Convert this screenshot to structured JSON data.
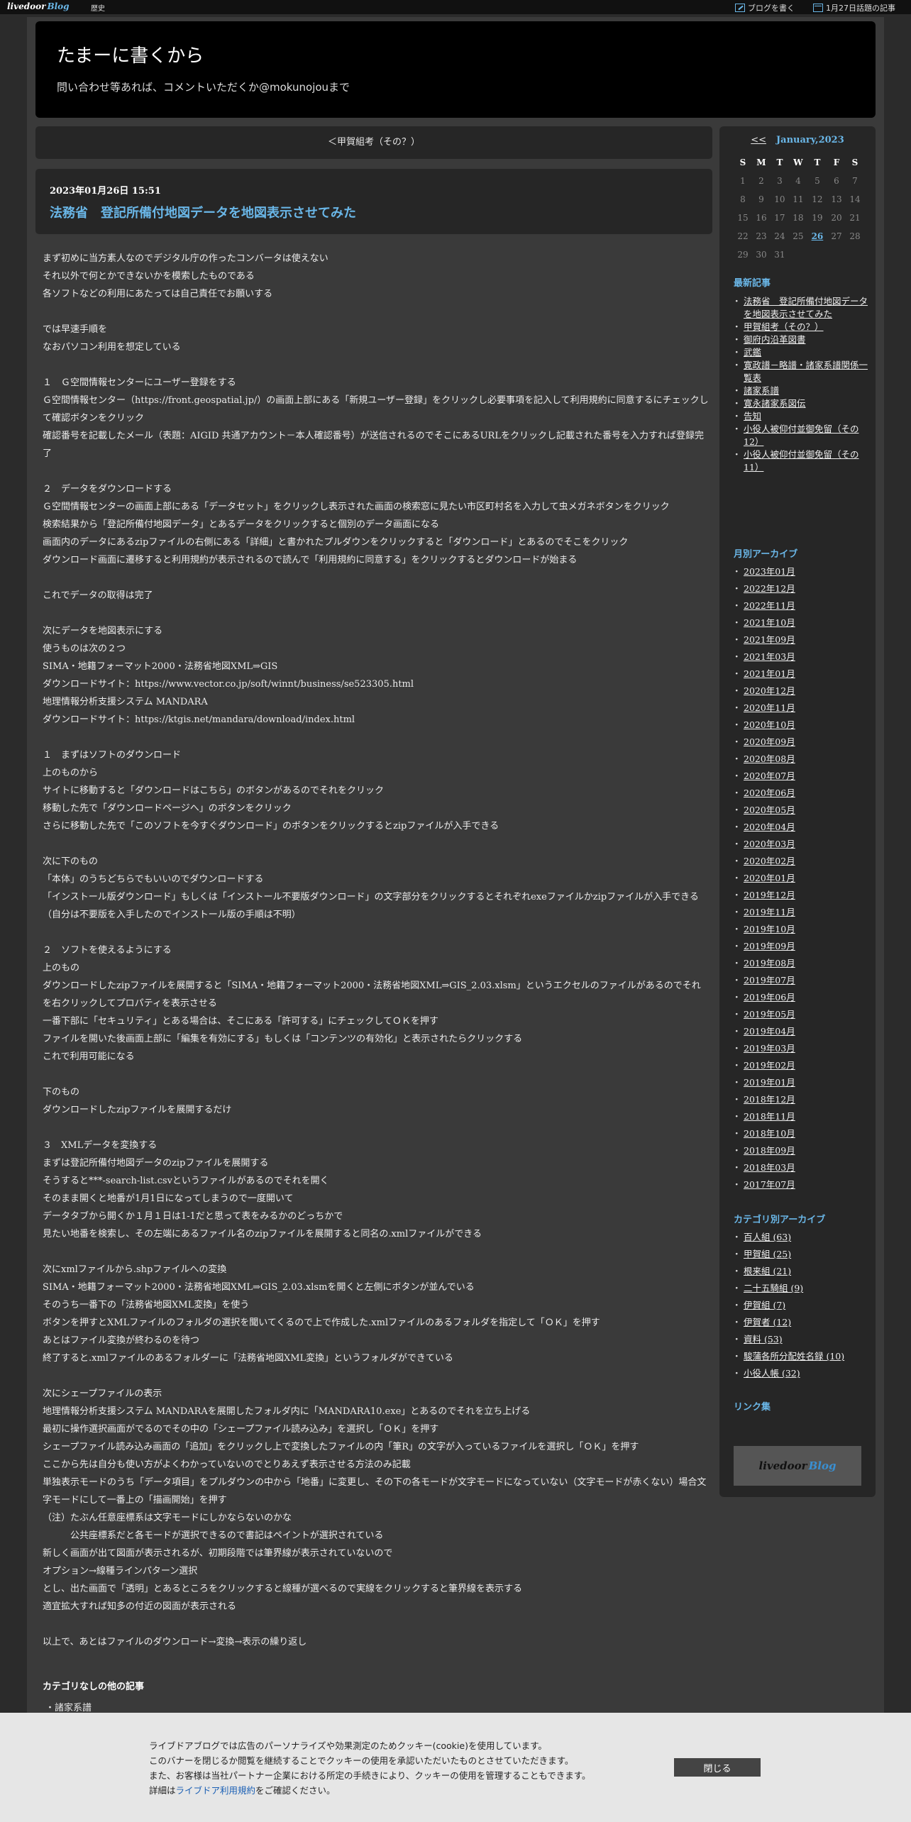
{
  "topbar": {
    "brand_1": "livedoor",
    "brand_2": "Blog",
    "history": "歴史",
    "write": "ブログを書く",
    "trending": "1月27日話題の記事"
  },
  "header": {
    "title": "たまーに書くから",
    "description": "問い合わせ等あれば、コメントいただくか@mokunojouまで"
  },
  "nav": {
    "prev": "＜甲賀組考（その？）"
  },
  "article": {
    "date": "2023年01月26日 15:51",
    "title": "法務省　登記所備付地図データを地図表示させてみた",
    "lines": [
      "まず初めに当方素人なのでデジタル庁の作ったコンバータは使えない",
      "それ以外で何とかできないかを模索したものである",
      "各ソフトなどの利用にあたっては自己責任でお願いする",
      "",
      "では早速手順を",
      "なおパソコン利用を想定している",
      "",
      "１　Ｇ空間情報センターにユーザー登録をする",
      "Ｇ空間情報センター（https://front.geospatial.jp/）の画面上部にある「新規ユーザー登録」をクリックし必要事項を記入して利用規約に同意するにチェックして確認ボタンをクリック",
      "確認番号を記載したメール（表題：AIGID 共通アカウント－本人確認番号）が送信されるのでそこにあるURLをクリックし記載された番号を入力すれば登録完了",
      "",
      "２　データをダウンロードする",
      "Ｇ空間情報センターの画面上部にある「データセット」をクリックし表示された画面の検索窓に見たい市区町村名を入力して虫メガネボタンをクリック",
      "検索結果から「登記所備付地図データ」とあるデータをクリックすると個別のデータ画面になる",
      "画面内のデータにあるzipファイルの右側にある「詳細」と書かれたプルダウンをクリックすると「ダウンロード」とあるのでそこをクリック",
      "ダウンロード画面に遷移すると利用規約が表示されるので読んで「利用規約に同意する」をクリックするとダウンロードが始まる",
      "",
      "これでデータの取得は完了",
      "",
      "次にデータを地図表示にする",
      "使うものは次の２つ",
      "SIMA・地籍フォーマット2000・法務省地図XML⇒GIS",
      "ダウンロードサイト：https://www.vector.co.jp/soft/winnt/business/se523305.html",
      "地理情報分析支援システム MANDARA",
      "ダウンロードサイト：https://ktgis.net/mandara/download/index.html",
      "",
      "１　まずはソフトのダウンロード",
      "上のものから",
      "サイトに移動すると「ダウンロードはこちら」のボタンがあるのでそれをクリック",
      "移動した先で「ダウンロードページへ」のボタンをクリック",
      "さらに移動した先で「このソフトを今すぐダウンロード」のボタンをクリックするとzipファイルが入手できる",
      "",
      "次に下のもの",
      "「本体」のうちどちらでもいいのでダウンロードする",
      "「インストール版ダウンロード」もしくは「インストール不要版ダウンロード」の文字部分をクリックするとそれぞれexeファイルかzipファイルが入手できる（自分は不要版を入手したのでインストール版の手順は不明）",
      "",
      "２　ソフトを使えるようにする",
      "上のもの",
      "ダウンロードしたzipファイルを展開すると「SIMA・地籍フォーマット2000・法務省地図XML⇒GIS_2.03.xlsm」というエクセルのファイルがあるのでそれを右クリックしてプロパティを表示させる",
      "一番下部に「セキュリティ」とある場合は、そこにある「許可する」にチェックしてＯＫを押す",
      "ファイルを開いた後画面上部に「編集を有効にする」もしくは「コンテンツの有効化」と表示されたらクリックする",
      "これで利用可能になる",
      "",
      "下のもの",
      "ダウンロードしたzipファイルを展開するだけ",
      "",
      "３　XMLデータを変換する",
      "まずは登記所備付地図データのzipファイルを展開する",
      "そうすると***-search-list.csvというファイルがあるのでそれを開く",
      "そのまま開くと地番が1月1日になってしまうので一度開いて",
      "データタブから開くか１月１日は1-1だと思って表をみるかのどっちかで",
      "見たい地番を検索し、その左端にあるファイル名のzipファイルを展開すると同名の.xmlファイルができる",
      "",
      "次にxmlファイルから.shpファイルへの変換",
      "SIMA・地籍フォーマット2000・法務省地図XML⇒GIS_2.03.xlsmを開くと左側にボタンが並んでいる",
      "そのうち一番下の「法務省地図XML変換」を使う",
      "ボタンを押すとXMLファイルのフォルダの選択を聞いてくるので上で作成した.xmlファイルのあるフォルダを指定して「ＯＫ」を押す",
      "あとはファイル変換が終わるのを待つ",
      "終了すると.xmlファイルのあるフォルダーに「法務省地図XML変換」というフォルダができている",
      "",
      "次にシェープファイルの表示",
      "地理情報分析支援システム MANDARAを展開したフォルダ内に「MANDARA10.exe」とあるのでそれを立ち上げる",
      "最初に操作選択画面がでるのでその中の「シェープファイル読み込み」を選択し「ＯＫ」を押す",
      "シェープファイル読み込み画面の「追加」をクリックし上で変換したファイルの内「筆R」の文字が入っているファイルを選択し「ＯＫ」を押す",
      "ここから先は自分も使い方がよくわかっていないのでとりあえず表示させる方法のみ記載",
      "単独表示モードのうち「データ項目」をプルダウンの中から「地番」に変更し、その下の各モードが文字モードになっていない（文字モードが赤くない）場合文字モードにして一番上の「描画開始」を押す",
      "（注）たぶん任意座標系は文字モードにしかならないのかな",
      "　　　公共座標系だと各モードが選択できるので書記はペイントが選択されている",
      "新しく画面が出て図面が表示されるが、初期段階では筆界線が表示されていないので",
      "オプション→線種ラインパターン選択",
      "とし、出た画面で「透明」とあるところをクリックすると線種が選べるので実線をクリックすると筆界線を表示する",
      "適宜拡大すれば知多の付近の図面が表示される",
      "",
      "以上で、あとはファイルのダウンロード→変換→表示の繰り返し"
    ]
  },
  "other": {
    "heading": "カテゴリなしの他の記事",
    "item": "諸家系譜"
  },
  "calendar": {
    "prev": "<<",
    "title": "January,2023",
    "weekdays": [
      "S",
      "M",
      "T",
      "W",
      "T",
      "F",
      "S"
    ],
    "weeks": [
      [
        "1",
        "2",
        "3",
        "4",
        "5",
        "6",
        "7"
      ],
      [
        "8",
        "9",
        "10",
        "11",
        "12",
        "13",
        "14"
      ],
      [
        "15",
        "16",
        "17",
        "18",
        "19",
        "20",
        "21"
      ],
      [
        "22",
        "23",
        "24",
        "25",
        "26",
        "27",
        "28"
      ],
      [
        "29",
        "30",
        "31",
        "",
        "",
        "",
        ""
      ]
    ],
    "linked_day": "26"
  },
  "recent": {
    "heading": "最新記事",
    "items": [
      "法務省　登記所備付地図データを地図表示させてみた",
      "甲賀組考（その？）",
      "御府内沿革図書",
      "武鑑",
      "寛政譜－略譜・諸家系譜関係一覧表",
      "諸家系譜",
      "寛永諸家系図伝",
      "告知",
      "小役人被仰付並御免留（その12）",
      "小役人被仰付並御免留（その11）"
    ]
  },
  "monthly": {
    "heading": "月別アーカイブ",
    "items": [
      "2023年01月",
      "2022年12月",
      "2022年11月",
      "2021年10月",
      "2021年09月",
      "2021年03月",
      "2021年01月",
      "2020年12月",
      "2020年11月",
      "2020年10月",
      "2020年09月",
      "2020年08月",
      "2020年07月",
      "2020年06月",
      "2020年05月",
      "2020年04月",
      "2020年03月",
      "2020年02月",
      "2020年01月",
      "2019年12月",
      "2019年11月",
      "2019年10月",
      "2019年09月",
      "2019年08月",
      "2019年07月",
      "2019年06月",
      "2019年05月",
      "2019年04月",
      "2019年03月",
      "2019年02月",
      "2019年01月",
      "2018年12月",
      "2018年11月",
      "2018年10月",
      "2018年09月",
      "2018年03月",
      "2017年07月"
    ]
  },
  "categories": {
    "heading": "カテゴリ別アーカイブ",
    "items": [
      "百人組 (63)",
      "甲賀組 (25)",
      "根来組 (21)",
      "二十五騎組 (9)",
      "伊賀組 (7)",
      "伊賀者 (12)",
      "資料 (53)",
      "駿蒲各所分配姓名録 (10)",
      "小役人帳 (32)"
    ]
  },
  "links": {
    "heading": "リンク集"
  },
  "badge": {
    "part1": "livedoor",
    "part2": "Blog"
  },
  "cookie": {
    "line1": "ライブドアブログでは広告のパーソナライズや効果測定のためクッキー(cookie)を使用しています。",
    "line2": "このバナーを閉じるか閲覧を継続することでクッキーの使用を承認いただいたものとさせていただきます。",
    "line3": "また、お客様は当社パートナー企業における所定の手続きにより、クッキーの使用を管理することもできます。",
    "line4_pre": "詳細は",
    "line4_link": "ライブドア利用規約",
    "line4_post": "をご確認ください。",
    "close": "閉じる"
  }
}
